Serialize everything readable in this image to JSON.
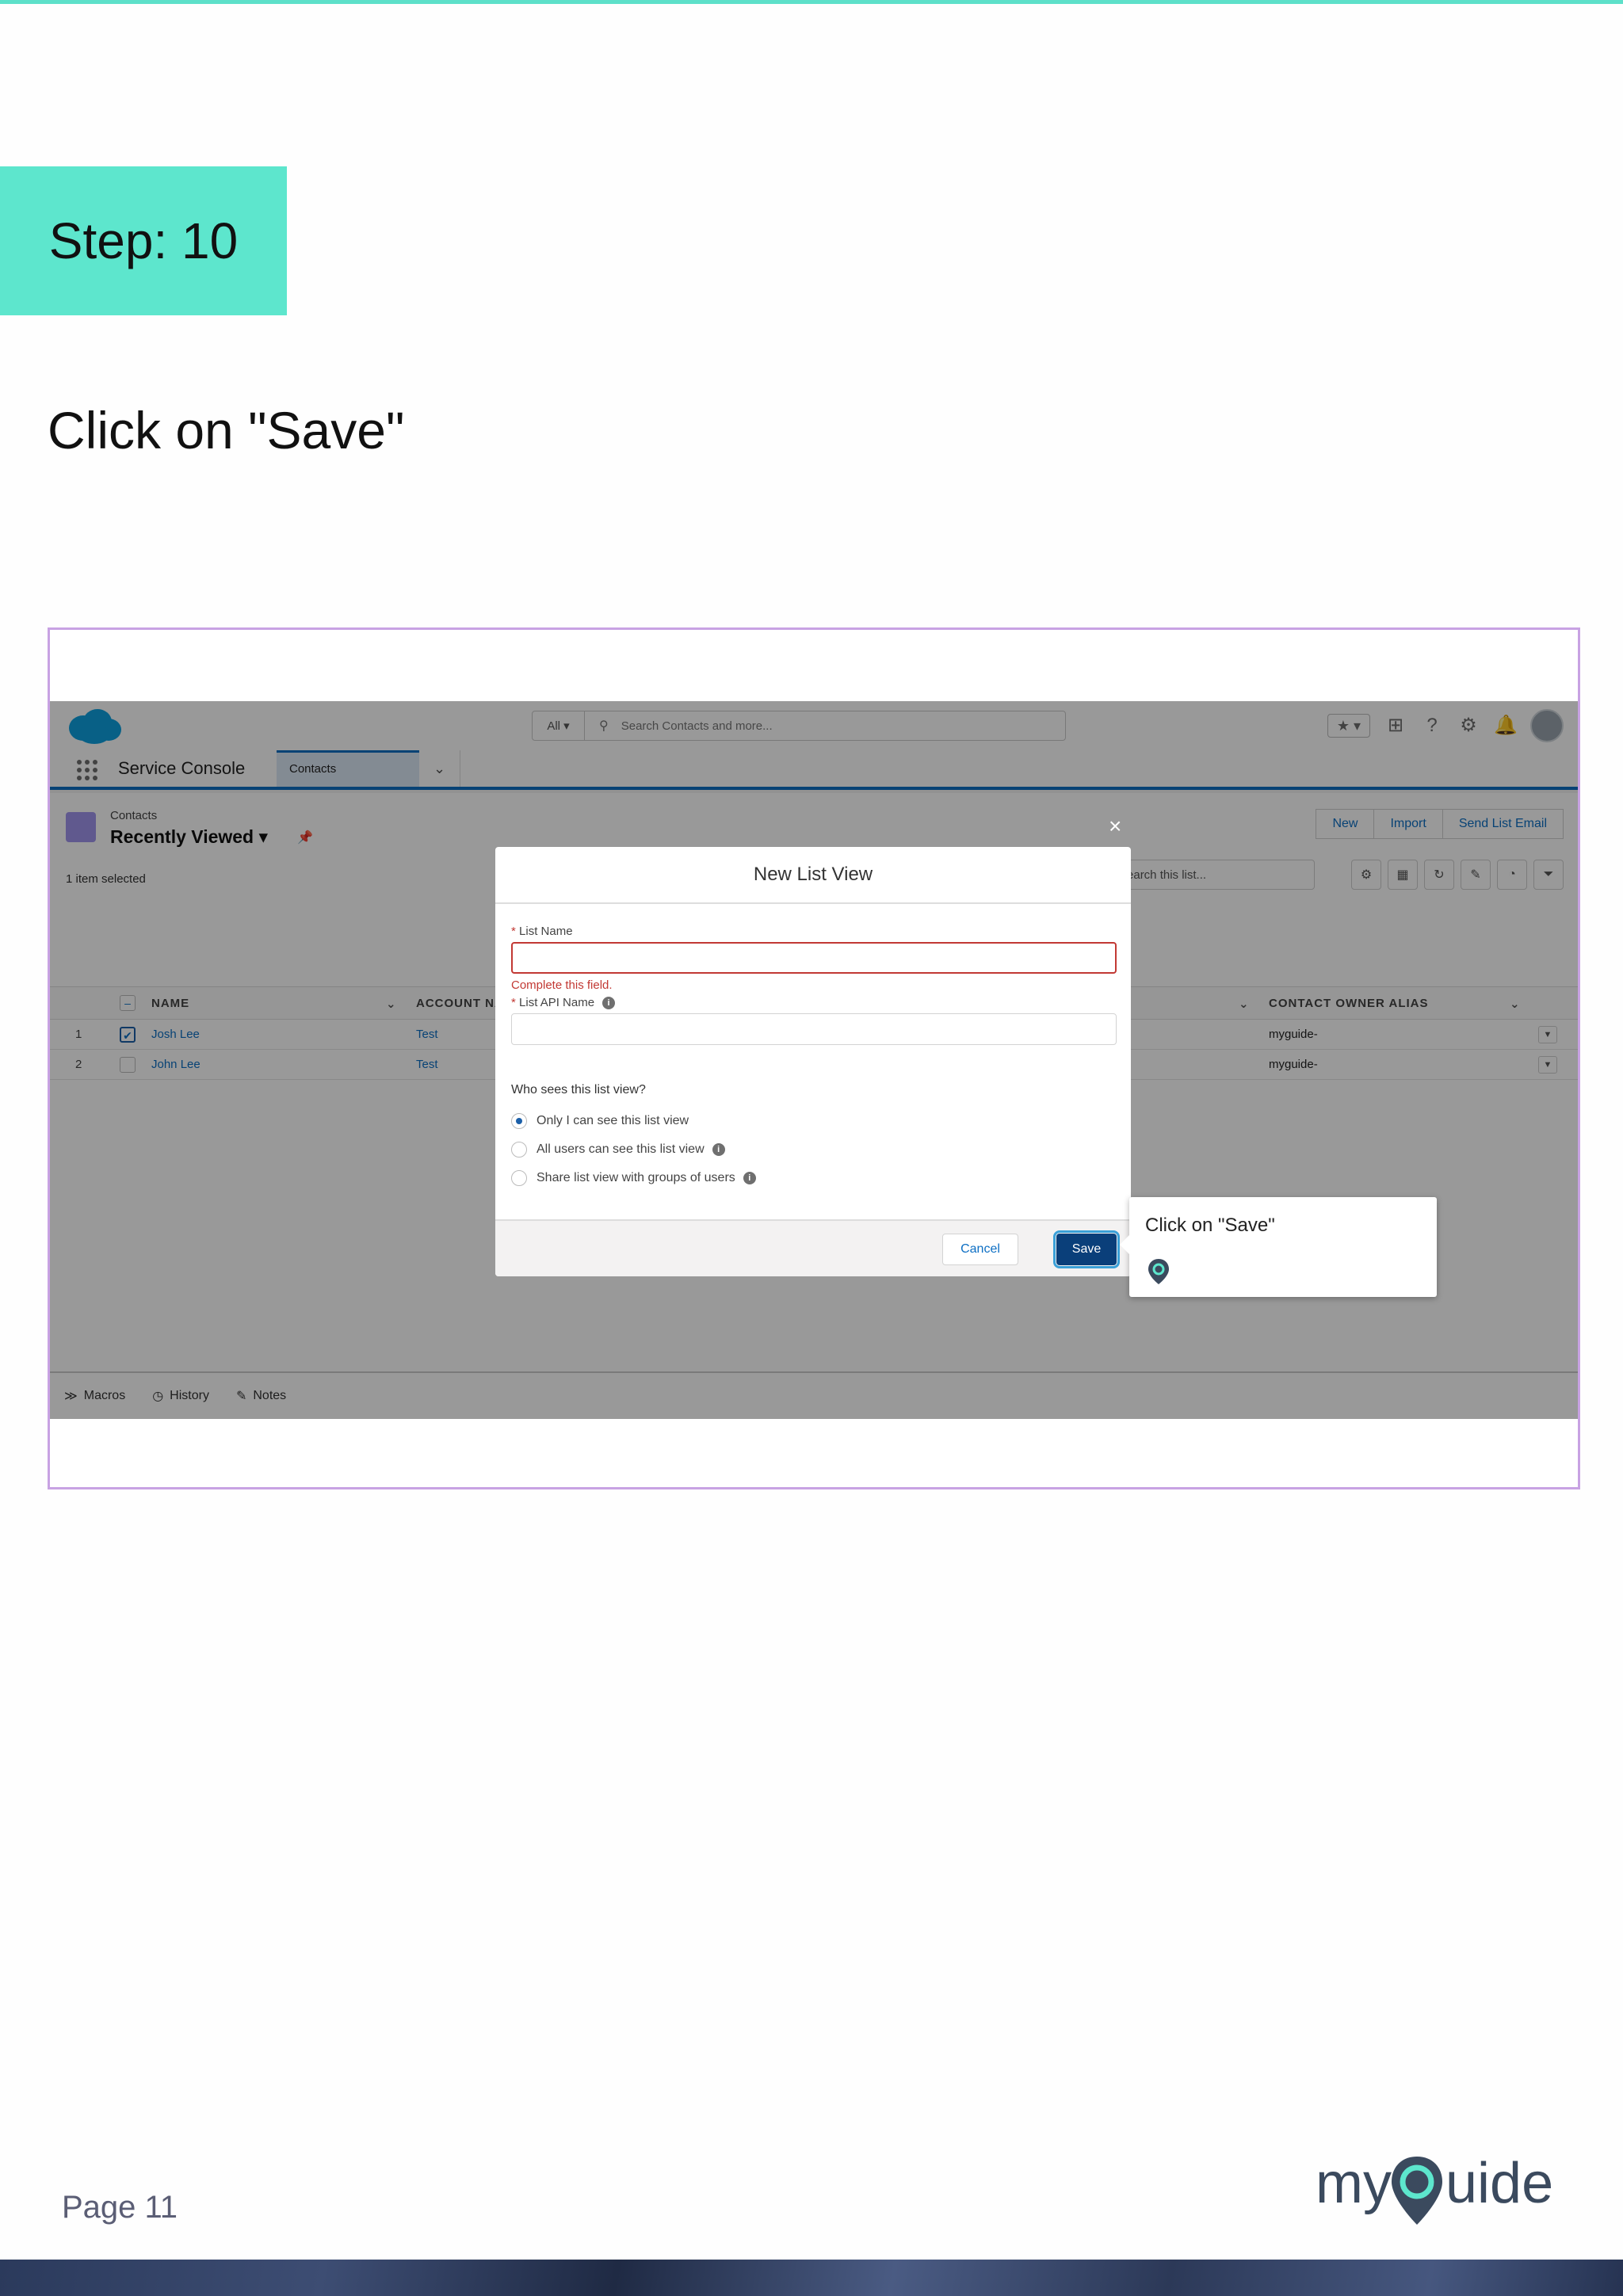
{
  "doc": {
    "step_label": "Step: 10",
    "instruction": "Click on \"Save\"",
    "page_number": "Page 11",
    "brand_logo_text": "myGuide"
  },
  "header": {
    "search_scope": "All",
    "search_placeholder": "Search Contacts and more..."
  },
  "nav": {
    "app_name": "Service Console",
    "tab_label": "Contacts"
  },
  "list_view": {
    "object_label": "Contacts",
    "view_name": "Recently Viewed",
    "item_count": "1 item selected",
    "buttons": [
      "New",
      "Import",
      "Send List Email"
    ],
    "search_placeholder": "Search this list...",
    "columns": {
      "name": "NAME",
      "account": "ACCOUNT NAME",
      "owner": "CONTACT OWNER ALIAS"
    },
    "rows": [
      {
        "num": "1",
        "name": "Josh Lee",
        "account": "Test",
        "owner": "myguide-",
        "checked": true
      },
      {
        "num": "2",
        "name": "John Lee",
        "account": "Test",
        "owner": "myguide-",
        "checked": false
      }
    ]
  },
  "utility_bar": {
    "items": [
      "Macros",
      "History",
      "Notes"
    ]
  },
  "modal": {
    "title": "New List View",
    "close_glyph": "×",
    "list_name_label": "List Name",
    "error_text": "Complete this field.",
    "api_name_label": "List API Name",
    "who_sees": "Who sees this list view?",
    "options": [
      "Only I can see this list view",
      "All users can see this list view",
      "Share list view with groups of users"
    ],
    "cancel_label": "Cancel",
    "save_label": "Save"
  },
  "tooltip": {
    "text": "Click on \"Save\""
  },
  "colors": {
    "accent_teal": "#5de6cd",
    "salesforce_blue": "#0d6fc4",
    "save_button": "#0a3f7a",
    "error_red": "#c23934",
    "frame_border": "#c8a2e3"
  }
}
